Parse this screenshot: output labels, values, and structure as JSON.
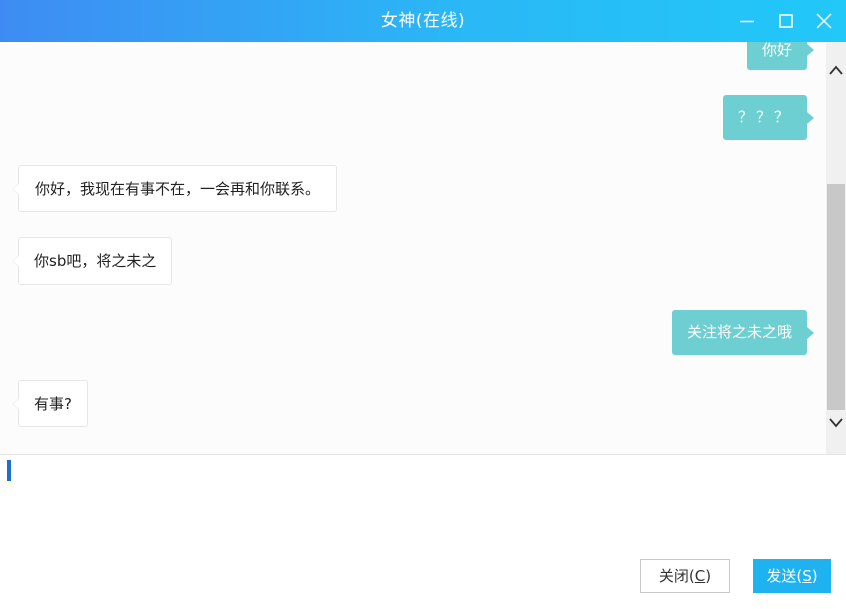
{
  "window": {
    "title": "女神(在线)"
  },
  "messages": [
    {
      "side": "out",
      "text": "你好"
    },
    {
      "side": "out",
      "text": "？？？"
    },
    {
      "side": "in",
      "text": "你好，我现在有事不在，一会再和你联系。"
    },
    {
      "side": "in",
      "text": "你sb吧，将之未之"
    },
    {
      "side": "out",
      "text": "关注将之未之哦"
    },
    {
      "side": "in",
      "text": "有事?"
    }
  ],
  "input": {
    "value": ""
  },
  "buttons": {
    "close_label": "关闭(",
    "close_hotkey": "C",
    "close_suffix": ")",
    "send_label": "发送(",
    "send_hotkey": "S",
    "send_suffix": ")"
  },
  "colors": {
    "titlebar_start": "#3e8cf3",
    "titlebar_end": "#21c8f8",
    "outgoing_bubble": "#6dcfd2",
    "send_button": "#1fb2f0"
  },
  "icons": {
    "minimize": "minimize-icon",
    "maximize": "maximize-icon",
    "close": "close-icon",
    "scroll_up": "chevron-up-icon",
    "scroll_down": "chevron-down-icon"
  }
}
